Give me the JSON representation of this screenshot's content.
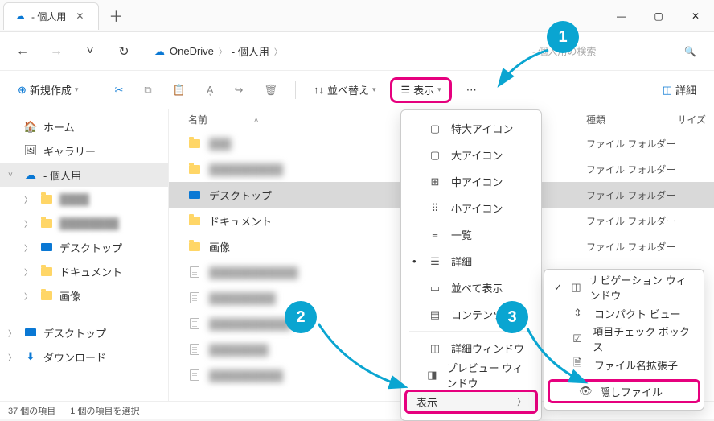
{
  "titlebar": {
    "tab_title": "- 個人用",
    "add_tab": "＋"
  },
  "nav": {
    "breadcrumb": [
      "OneDrive",
      "- 個人用"
    ],
    "search_placeholder": "- 個人用の検索"
  },
  "toolbar": {
    "new": "新規作成",
    "sort": "並べ替え",
    "view": "表示",
    "details": "詳細"
  },
  "sidebar": {
    "home": "ホーム",
    "gallery": "ギャラリー",
    "personal": "- 個人用",
    "desktop": "デスクトップ",
    "documents": "ドキュメント",
    "pictures": "画像",
    "desktop2": "デスクトップ",
    "downloads": "ダウンロード"
  },
  "columns": {
    "name": "名前",
    "type": "種類",
    "size": "サイズ"
  },
  "files": {
    "desktop": "デスクトップ",
    "documents": "ドキュメント",
    "pictures": "画像"
  },
  "type_values": {
    "folder": "ファイル フォルダー"
  },
  "dropdown": {
    "extra_large": "特大アイコン",
    "large": "大アイコン",
    "medium": "中アイコン",
    "small": "小アイコン",
    "list": "一覧",
    "details": "詳細",
    "tiles": "並べて表示",
    "content": "コンテンツ",
    "details_pane": "詳細ウィンドウ",
    "preview_pane": "プレビュー ウィンドウ",
    "show": "表示"
  },
  "submenu": {
    "nav_pane": "ナビゲーション ウィンドウ",
    "compact": "コンパクト ビュー",
    "checkboxes": "項目チェック ボックス",
    "extensions": "ファイル名拡張子",
    "hidden": "隠しファイル"
  },
  "status": {
    "count": "37 個の項目",
    "selected": "1 個の項目を選択"
  },
  "callouts": {
    "c1": "1",
    "c2": "2",
    "c3": "3"
  }
}
